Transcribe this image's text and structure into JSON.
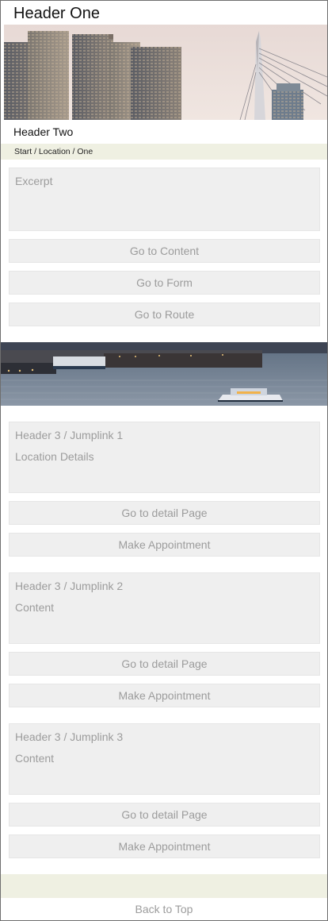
{
  "header_one": "Header One",
  "header_two": "Header Two",
  "breadcrumb": "Start / Location / One",
  "excerpt": "Excerpt",
  "nav_buttons": [
    "Go to Content",
    "Go to Form",
    "Go to Route"
  ],
  "locations": [
    {
      "heading": "Header 3 / Jumplink 1",
      "body": "Location Details",
      "detail_label": "Go to detail Page",
      "appointment_label": "Make Appointment"
    },
    {
      "heading": "Header 3 / Jumplink 2",
      "body": "Content",
      "detail_label": "Go to detail Page",
      "appointment_label": "Make Appointment"
    },
    {
      "heading": "Header 3 / Jumplink 3",
      "body": "Content",
      "detail_label": "Go to detail Page",
      "appointment_label": "Make Appointment"
    }
  ],
  "back_to_top": "Back to Top",
  "colors": {
    "band": "#eff0e2",
    "box": "#efefef",
    "muted_text": "#9c9c9c"
  }
}
